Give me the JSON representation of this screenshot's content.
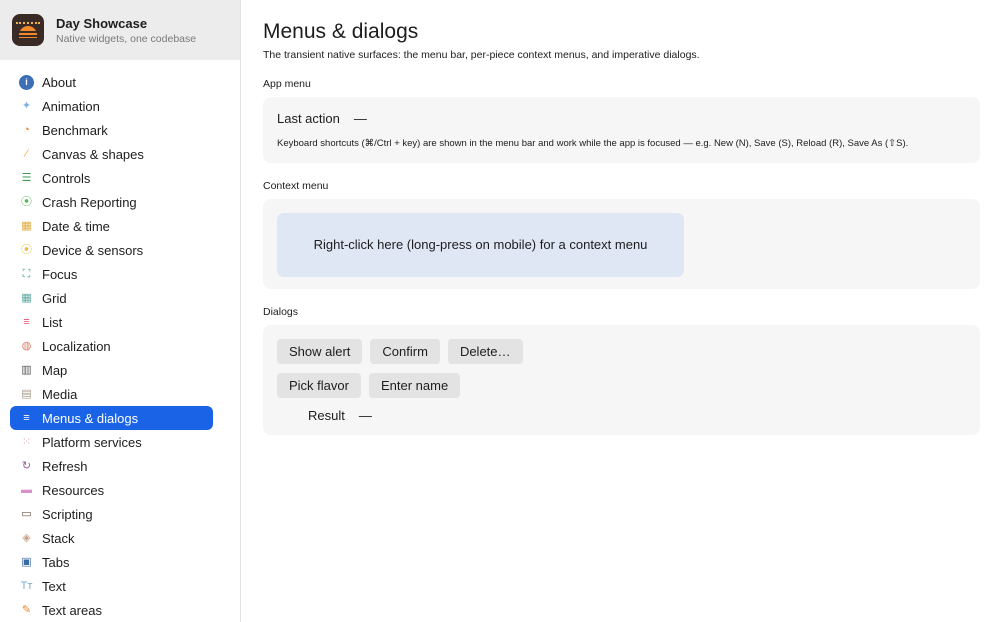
{
  "app": {
    "name": "Day Showcase",
    "subtitle": "Native widgets, one codebase"
  },
  "sidebar": {
    "items": [
      {
        "label": "About",
        "icon": "info-icon",
        "color": "#3d6fb6",
        "glyph": "i"
      },
      {
        "label": "Animation",
        "icon": "sparkles-icon",
        "color": "#7db0e8",
        "glyph": "✦"
      },
      {
        "label": "Benchmark",
        "icon": "gauge-icon",
        "color": "#f07f24",
        "glyph": "◔"
      },
      {
        "label": "Canvas & shapes",
        "icon": "brush-icon",
        "color": "#f0a54a",
        "glyph": "∕"
      },
      {
        "label": "Controls",
        "icon": "sliders-icon",
        "color": "#3e9a55",
        "glyph": "☰"
      },
      {
        "label": "Crash Reporting",
        "icon": "broadcast-icon",
        "color": "#5ab55a",
        "glyph": "⦿"
      },
      {
        "label": "Date & time",
        "icon": "calendar-icon",
        "color": "#e0a83a",
        "glyph": "▦"
      },
      {
        "label": "Device & sensors",
        "icon": "sensor-icon",
        "color": "#e8b93a",
        "glyph": "⦿"
      },
      {
        "label": "Focus",
        "icon": "focus-icon",
        "color": "#3aa08a",
        "glyph": "⛶"
      },
      {
        "label": "Grid",
        "icon": "grid-icon",
        "color": "#5aa8a0",
        "glyph": "▦"
      },
      {
        "label": "List",
        "icon": "list-icon",
        "color": "#e0506a",
        "glyph": "≡"
      },
      {
        "label": "Localization",
        "icon": "globe-icon",
        "color": "#e07a60",
        "glyph": "◍"
      },
      {
        "label": "Map",
        "icon": "map-icon",
        "color": "#555555",
        "glyph": "▥"
      },
      {
        "label": "Media",
        "icon": "clapper-icon",
        "color": "#a89a8a",
        "glyph": "▤"
      },
      {
        "label": "Menus & dialogs",
        "icon": "menu-icon",
        "color": "#ffffff",
        "glyph": "≡"
      },
      {
        "label": "Platform services",
        "icon": "dots-grid-icon",
        "color": "#e8a0b0",
        "glyph": "⁙"
      },
      {
        "label": "Refresh",
        "icon": "refresh-icon",
        "color": "#9a5aa0",
        "glyph": "↻"
      },
      {
        "label": "Resources",
        "icon": "folder-icon",
        "color": "#d890c8",
        "glyph": "▬"
      },
      {
        "label": "Scripting",
        "icon": "terminal-icon",
        "color": "#6a5a4a",
        "glyph": "▭"
      },
      {
        "label": "Stack",
        "icon": "layers-icon",
        "color": "#c8a088",
        "glyph": "◈"
      },
      {
        "label": "Tabs",
        "icon": "tabs-icon",
        "color": "#3a6aa0",
        "glyph": "▣"
      },
      {
        "label": "Text",
        "icon": "text-icon",
        "color": "#7aaad0",
        "glyph": "Tт"
      },
      {
        "label": "Text areas",
        "icon": "edit-doc-icon",
        "color": "#f07f24",
        "glyph": "✎"
      }
    ],
    "active_index": 14
  },
  "main": {
    "title": "Menus & dialogs",
    "description": "The transient native surfaces: the menu bar, per-piece context menus, and imperative dialogs.",
    "app_menu": {
      "label": "App menu",
      "last_action_label": "Last action",
      "last_action_value": "—",
      "hint": "Keyboard shortcuts (⌘/Ctrl + key) are shown in the menu bar and work while the app is focused — e.g. New (N), Save (S), Reload (R), Save As (⇧S)."
    },
    "context_menu": {
      "label": "Context menu",
      "area_text": "Right-click here (long-press on mobile) for a context menu"
    },
    "dialogs": {
      "label": "Dialogs",
      "buttons_row1": [
        "Show alert",
        "Confirm",
        "Delete…"
      ],
      "buttons_row2": [
        "Pick flavor",
        "Enter name"
      ],
      "result_label": "Result",
      "result_value": "—"
    }
  }
}
